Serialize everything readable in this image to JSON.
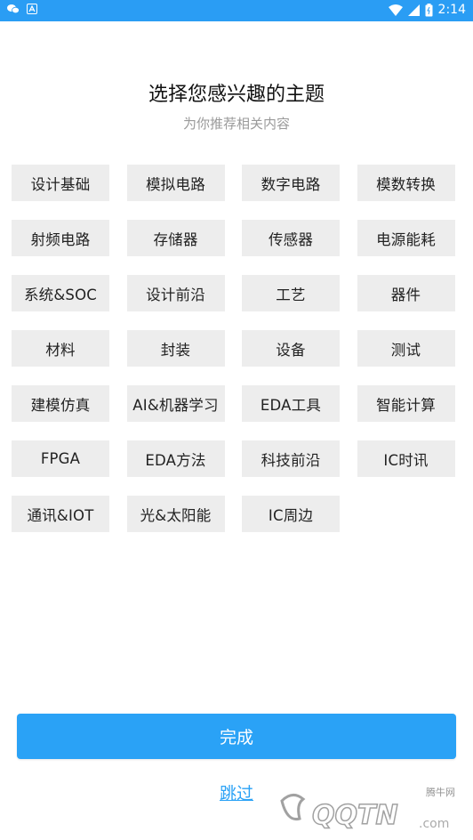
{
  "status_bar": {
    "time": "2:14",
    "icons": [
      "wechat-icon",
      "app-icon",
      "wifi-icon",
      "signal-icon",
      "battery-icon"
    ]
  },
  "header": {
    "title": "选择您感兴趣的主题",
    "subtitle": "为你推荐相关内容"
  },
  "topics": [
    {
      "label": "设计基础"
    },
    {
      "label": "模拟电路"
    },
    {
      "label": "数字电路"
    },
    {
      "label": "模数转换"
    },
    {
      "label": "射频电路"
    },
    {
      "label": "存储器"
    },
    {
      "label": "传感器"
    },
    {
      "label": "电源能耗"
    },
    {
      "label": "系统&SOC"
    },
    {
      "label": "设计前沿"
    },
    {
      "label": "工艺"
    },
    {
      "label": "器件"
    },
    {
      "label": "材料"
    },
    {
      "label": "封装"
    },
    {
      "label": "设备"
    },
    {
      "label": "测试"
    },
    {
      "label": "建模仿真"
    },
    {
      "label": "AI&机器学习"
    },
    {
      "label": "EDA工具"
    },
    {
      "label": "智能计算"
    },
    {
      "label": "FPGA"
    },
    {
      "label": "EDA方法"
    },
    {
      "label": "科技前沿"
    },
    {
      "label": "IC时讯"
    },
    {
      "label": "通讯&IOT"
    },
    {
      "label": "光&太阳能"
    },
    {
      "label": "IC周边"
    }
  ],
  "actions": {
    "done_label": "完成",
    "skip_label": "跳过"
  },
  "watermark": {
    "text": "腾牛网",
    "logo_text": "QQTN.com"
  },
  "colors": {
    "status_bar": "#2a9df4",
    "accent": "#2aa2f6",
    "chip_bg": "#ededed",
    "subtitle": "#9a9a9a"
  }
}
